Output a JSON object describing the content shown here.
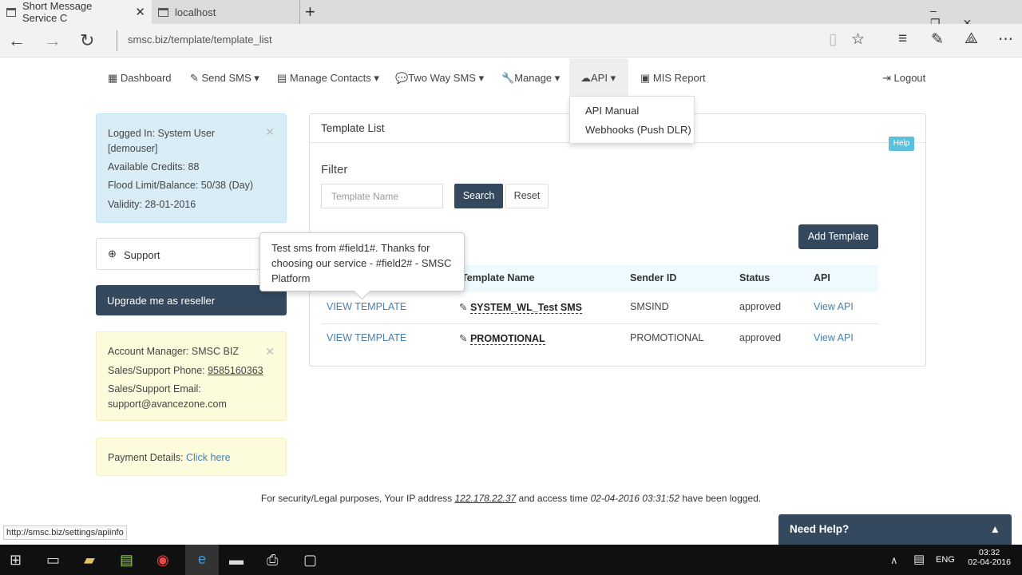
{
  "browser": {
    "tabs": [
      {
        "label": "Short Message Service C"
      },
      {
        "label": "localhost"
      }
    ],
    "new_tab": "+",
    "url": "smsc.biz/template/template_list",
    "status_url": "http://smsc.biz/settings/apiinfo"
  },
  "nav": {
    "items": [
      "Dashboard",
      "Send SMS",
      "Manage Contacts",
      "Two Way SMS",
      "Manage",
      "API",
      "MIS Report"
    ],
    "logout": "Logout",
    "api_menu": [
      "API Manual",
      "Webhooks (Push DLR)"
    ]
  },
  "info": {
    "logged": "Logged In: System User",
    "user": "[demouser]",
    "credits": "Available Credits: 88",
    "flood": "Flood Limit/Balance: 50/38 (Day)",
    "validity": "Validity: 28-01-2016"
  },
  "support": "Support",
  "reseller": "Upgrade me as reseller",
  "account": {
    "manager": "Account Manager: SMSC BIZ",
    "phone_label": "Sales/Support Phone: ",
    "phone": "9585160363",
    "email_label": "Sales/Support Email:",
    "email": "support@avancezone.com"
  },
  "payment": {
    "label": "Payment Details: ",
    "link": "Click here"
  },
  "main": {
    "title": "Template List",
    "help": "Help",
    "filter": "Filter",
    "placeholder": "Template Name",
    "search": "Search",
    "reset": "Reset",
    "add": "Add Template",
    "columns": [
      "Template Name",
      "Sender ID",
      "Status",
      "API"
    ],
    "rows": [
      {
        "view": "VIEW TEMPLATE",
        "name": "SYSTEM_WL_Test SMS",
        "sender": "SMSIND",
        "status": "approved",
        "api": "View API"
      },
      {
        "view": "VIEW TEMPLATE",
        "name": "PROMOTIONAL",
        "sender": "PROMOTIONAL",
        "status": "approved",
        "api": "View API"
      }
    ],
    "tooltip": "Test sms from #field1#. Thanks for choosing our service - #field2# - SMSC Platform"
  },
  "footer": {
    "a": "For security/Legal purposes, Your IP address ",
    "ip": "122.178.22.37",
    "b": " and access time ",
    "time": "02-04-2016 03:31:52",
    "c": " have been logged."
  },
  "needhelp": "Need Help?",
  "taskbar": {
    "lang": "ENG",
    "time": "03:32",
    "date": "02-04-2016"
  }
}
